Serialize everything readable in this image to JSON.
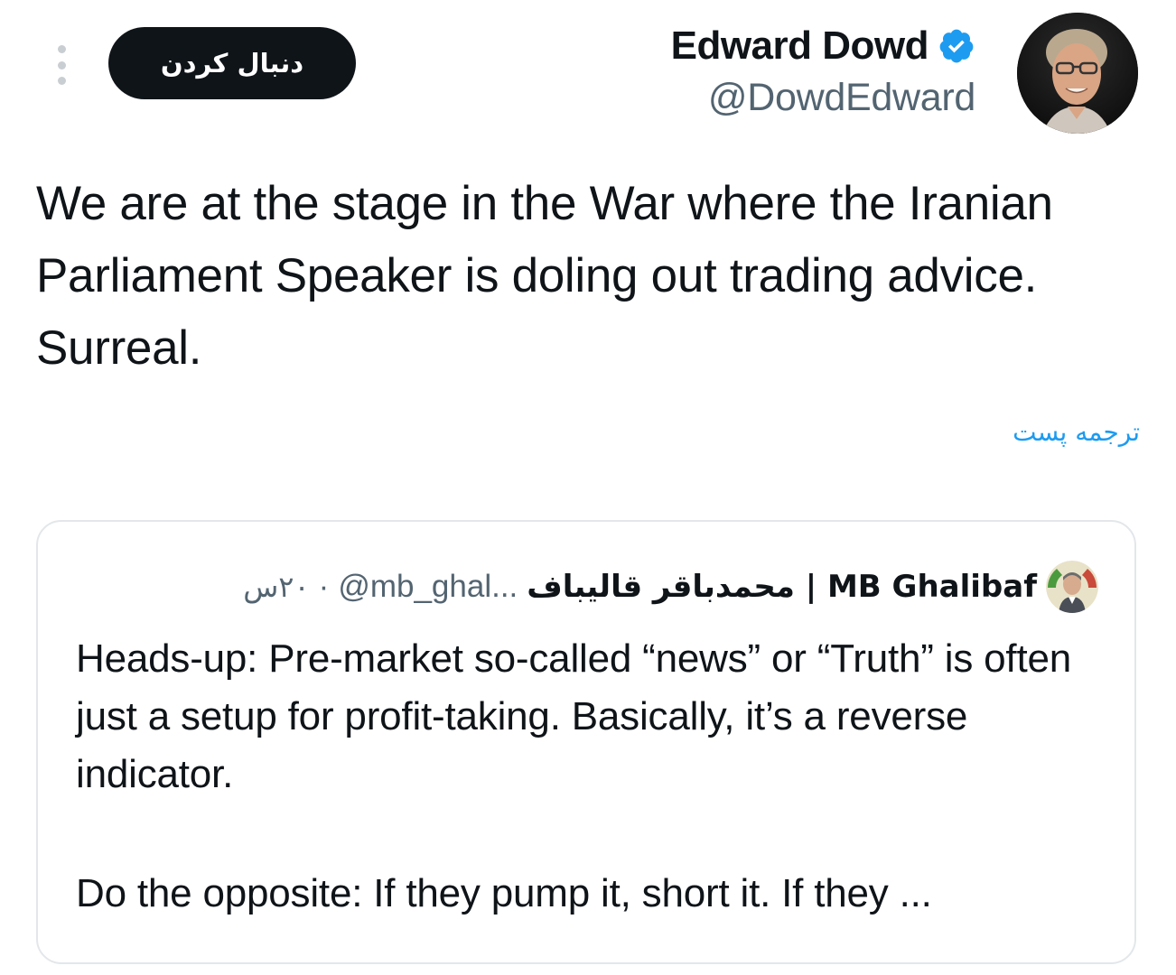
{
  "header": {
    "follow_label": "دنبال کردن",
    "author_name": "Edward Dowd",
    "author_handle": "@DowdEdward",
    "more_icon": "more-dots-icon",
    "verified_icon": "verified-badge-icon"
  },
  "tweet": {
    "text": "We are at the stage in the War where the Iranian Parliament Speaker is doling out trading advice. Surreal.",
    "translate_label": "ترجمه پست"
  },
  "quote": {
    "author_name": "محمدباقر قالیباف | MB Ghalibaf",
    "author_handle": "@mb_ghal...",
    "separator": "·",
    "time": "۲۰س",
    "paragraph_1": "Heads-up: Pre-market so-called “news” or “Truth” is often just a setup for profit-taking. Basically, it’s a reverse indicator.",
    "paragraph_2": "Do the opposite: If they pump it, short it. If they ..."
  },
  "colors": {
    "text_primary": "#0f1419",
    "text_secondary": "#536471",
    "link_blue": "#1d9bf0",
    "verified_blue": "#1d9bf0",
    "follow_bg": "#0f1419",
    "border": "#e3e7ea"
  }
}
